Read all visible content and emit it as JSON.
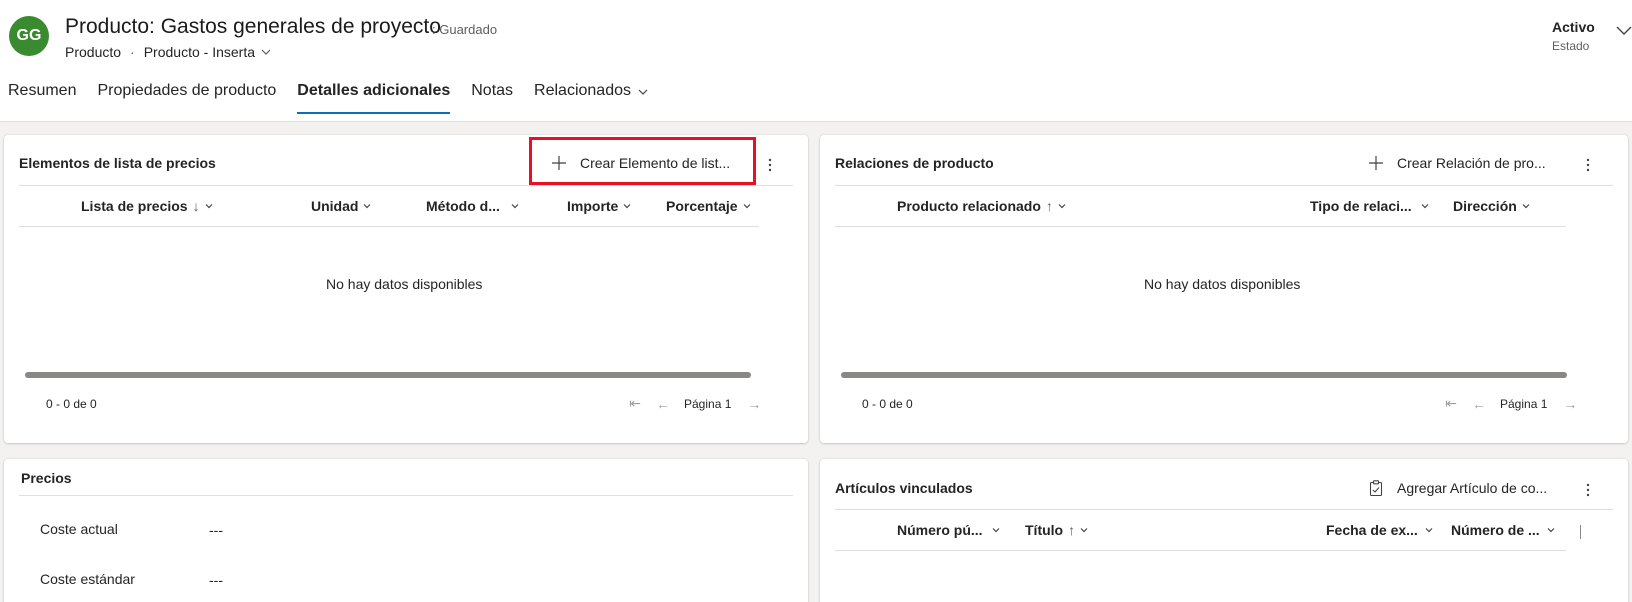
{
  "header": {
    "avatar_initials": "GG",
    "avatar_color": "#3a8a2f",
    "title": "Producto: Gastos generales de proyecto",
    "save_status": ": Guardado",
    "breadcrumb_entity": "Producto",
    "breadcrumb_separator": "·",
    "breadcrumb_form": "Producto - Inserta",
    "status_value": "Activo",
    "status_label": "Estado"
  },
  "tabs": [
    {
      "label": "Resumen"
    },
    {
      "label": "Propiedades de producto"
    },
    {
      "label": "Detalles adicionales",
      "active": true
    },
    {
      "label": "Notas"
    },
    {
      "label": "Relacionados"
    }
  ],
  "price_list_items": {
    "title": "Elementos de lista de precios",
    "create_label": "Crear Elemento de list...",
    "columns": [
      "Lista de precios",
      "Unidad",
      "Método d...",
      "Importe",
      "Porcentaje"
    ],
    "sort_arrow": "↓",
    "no_data": "No hay datos disponibles",
    "count": "0 - 0 de 0",
    "page": "Página 1"
  },
  "product_relations": {
    "title": "Relaciones de producto",
    "create_label": "Crear Relación de pro...",
    "columns": [
      "Producto relacionado",
      "Tipo de relaci...",
      "Dirección"
    ],
    "sort_arrow": "↑",
    "no_data": "No hay datos disponibles",
    "count": "0 - 0 de 0",
    "page": "Página 1"
  },
  "pricing": {
    "title": "Precios",
    "fields": [
      {
        "label": "Coste actual",
        "value": "---"
      },
      {
        "label": "Coste estándar",
        "value": "---"
      }
    ]
  },
  "linked_articles": {
    "title": "Artículos vinculados",
    "add_label": "Agregar Artículo de co...",
    "columns": [
      "Número pú...",
      "Título",
      "Fecha de ex...",
      "Número de ..."
    ],
    "sort_arrow": "↑"
  },
  "colors": {
    "accent": "#0f6cbd",
    "highlight": "#e81123"
  }
}
